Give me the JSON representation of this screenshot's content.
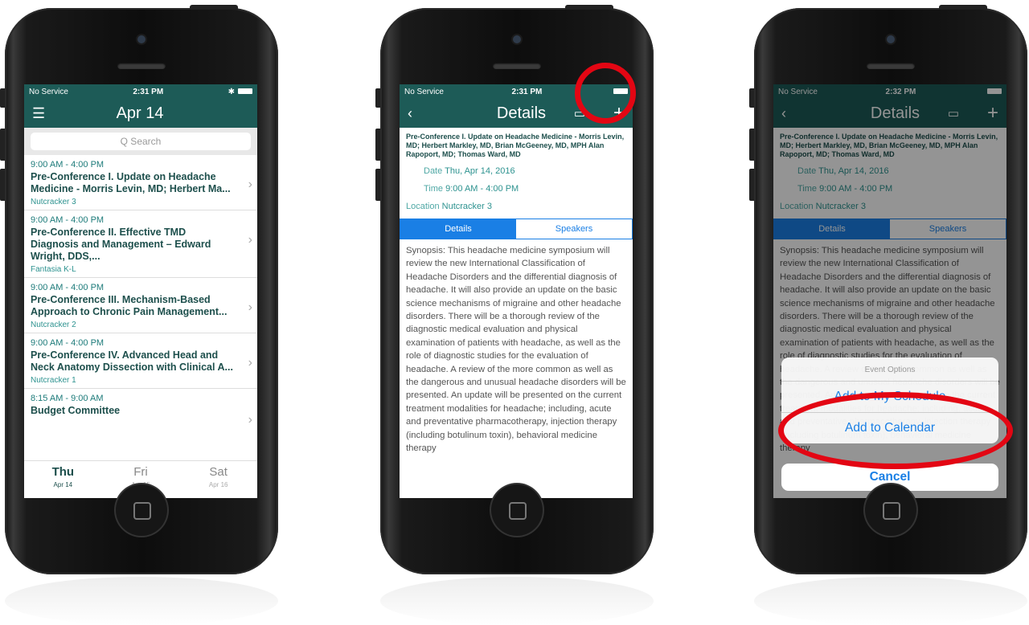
{
  "phones": [
    {
      "status": {
        "carrier": "No Service",
        "time": "2:31 PM"
      },
      "nav": {
        "title": "Apr 14"
      },
      "search": {
        "placeholder": "Q Search"
      },
      "sessions": [
        {
          "time": "9:00 AM - 4:00 PM",
          "name": "Pre-Conference I. Update on Headache Medicine - Morris Levin, MD; Herbert Ma...",
          "location": "Nutcracker 3"
        },
        {
          "time": "9:00 AM - 4:00 PM",
          "name": "Pre-Conference II. Effective TMD Diagnosis and Management – Edward Wright, DDS,...",
          "location": "Fantasia K-L"
        },
        {
          "time": "9:00 AM - 4:00 PM",
          "name": "Pre-Conference III. Mechanism-Based Approach to Chronic Pain Management...",
          "location": "Nutcracker 2"
        },
        {
          "time": "9:00 AM - 4:00 PM",
          "name": "Pre-Conference IV. Advanced Head and Neck Anatomy Dissection with Clinical A...",
          "location": "Nutcracker 1"
        },
        {
          "time": "8:15 AM - 9:00 AM",
          "name": "Budget Committee",
          "location": ""
        }
      ],
      "days": [
        {
          "day": "Thu",
          "date": "Apr 14"
        },
        {
          "day": "Fri",
          "date": "Apr 15"
        },
        {
          "day": "Sat",
          "date": "Apr 16"
        }
      ]
    },
    {
      "status": {
        "carrier": "No Service",
        "time": "2:31 PM"
      },
      "nav": {
        "title": "Details",
        "add": "+"
      },
      "header": "Pre-Conference I. Update on Headache Medicine - Morris Levin, MD; Herbert Markley, MD, Brian McGeeney, MD, MPH Alan Rapoport, MD; Thomas Ward, MD",
      "date_label": "Date",
      "date": "Thu, Apr 14, 2016",
      "time_label": "Time",
      "time": "9:00 AM - 4:00 PM",
      "location_label": "Location",
      "location": "Nutcracker 3",
      "tabs": [
        "Details",
        "Speakers"
      ],
      "synopsis": "Synopsis: This headache medicine symposium will review the new International Classification of Headache Disorders and the differential diagnosis of headache. It will also provide an update on the basic science mechanisms of migraine and other headache disorders. There will be a thorough review of the diagnostic medical evaluation and physical examination of patients with headache, as well as the role of diagnostic studies for the evaluation of headache. A review of the more common as well as the dangerous and unusual headache disorders will be presented. An update will be presented on the current treatment modalities for headache; including, acute and preventative pharmacotherapy, injection therapy (including botulinum toxin), behavioral medicine therapy"
    },
    {
      "status": {
        "carrier": "No Service",
        "time": "2:32 PM"
      },
      "nav": {
        "title": "Details",
        "add": "+"
      },
      "sheet": {
        "title": "Event Options",
        "options": [
          "Add to My Schedule",
          "Add to Calendar"
        ],
        "cancel": "Cancel"
      }
    }
  ],
  "colors": {
    "teal": "#1d5b57",
    "blue": "#1a7fe5",
    "ring": "#e30613"
  }
}
